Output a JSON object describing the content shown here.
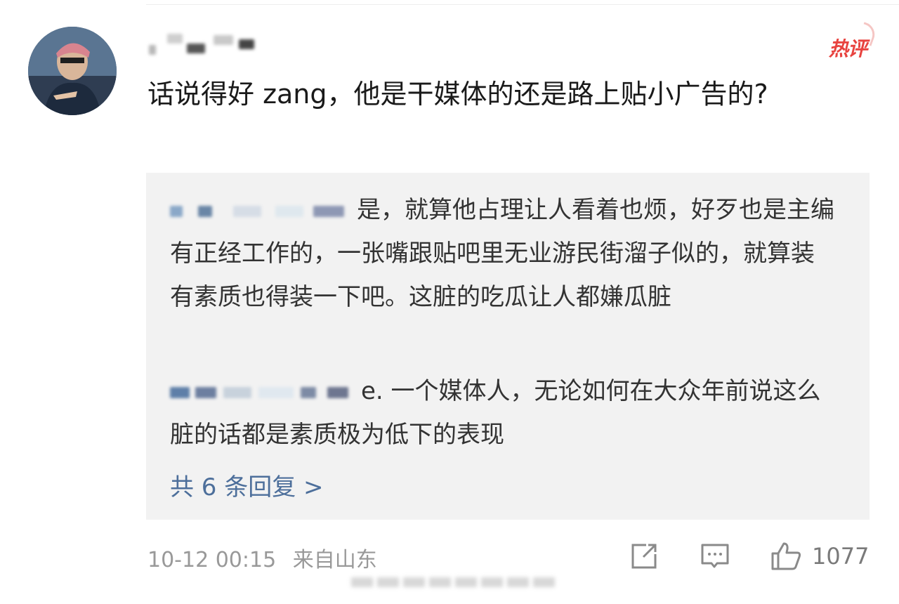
{
  "comment": {
    "badge": "热评",
    "text": "话说得好 zang，他是干媒体的还是路上贴小广告的?",
    "avatar_icon": "profile-photo"
  },
  "replies": [
    {
      "text": "是，就算他占理让人看着也烦，好歹也是主编有正经工作的，一张嘴跟贴吧里无业游民街溜子似的，就算装有素质也得装一下吧。这脏的吃瓜让人都嫌瓜脏"
    },
    {
      "text": "e. 一个媒体人，无论如何在大众年前说这么脏的话都是素质极为低下的表现"
    }
  ],
  "more_replies_label": "共 6 条回复 >",
  "footer": {
    "timestamp": "10-12 00:15",
    "location": "来自山东",
    "like_count": "1077",
    "share_icon": "share-icon",
    "comment_icon": "comment-icon",
    "like_icon": "thumbs-up-icon"
  },
  "colors": {
    "badge_red": "#e8433f",
    "link_blue": "#4d6f9b",
    "reply_bg": "#f2f2f2",
    "meta_gray": "#999999"
  }
}
